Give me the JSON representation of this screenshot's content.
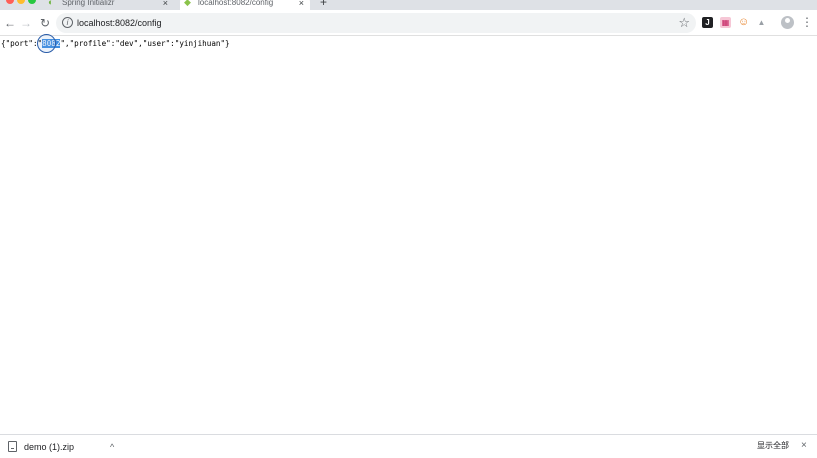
{
  "tabs": [
    {
      "title": "Spring Initializr",
      "favicon": "spring-icon",
      "active": false
    },
    {
      "title": "localhost:8082/config",
      "favicon": "leaf-icon",
      "active": true
    }
  ],
  "tab_close_glyph": "×",
  "new_tab_glyph": "+",
  "toolbar": {
    "url": "localhost:8082/config",
    "back_glyph": "←",
    "forward_glyph": "→",
    "reload_glyph": "↻",
    "star_glyph": "☆",
    "ext_j_label": "J",
    "menu_glyph": "⋮"
  },
  "page": {
    "json_prefix": "{\"port\":\"",
    "json_selected": "8082",
    "json_suffix": "\",\"profile\":\"dev\",\"user\":\"yinjihuan\"}"
  },
  "downloads": {
    "file_name": "demo (1).zip",
    "caret_glyph": "^",
    "show_all_label": "显示全部",
    "close_glyph": "×"
  },
  "colors": {
    "tabstrip_bg": "#dee1e6",
    "selection": "#3d8ce0",
    "traffic_red": "#ff5f57",
    "traffic_yellow": "#febc2e",
    "traffic_green": "#28c840"
  }
}
